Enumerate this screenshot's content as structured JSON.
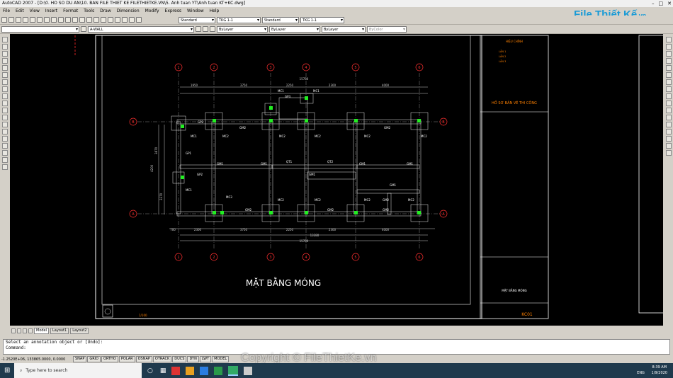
{
  "window": {
    "title": "AutoCAD 2007 - [D:\\0. HO SO DU AN\\10. BAN FILE THIET KE FILETHIETKE.VN\\5. Anh tuan YT\\Anh tuan KT+KC.dwg]"
  },
  "menu": [
    "File",
    "Edit",
    "View",
    "Insert",
    "Format",
    "Tools",
    "Draw",
    "Dimension",
    "Modify",
    "Express",
    "Window",
    "Help"
  ],
  "toolbar": {
    "text_style": "Standard",
    "dim_style": "TKG 1-1",
    "table_style": "Standard",
    "mleader_style": "TKG 1-1",
    "layer": "A-WALL",
    "color": "ByLayer",
    "linetype": "ByLayer",
    "lineweight": "ByLayer",
    "plotstyle": "ByColor"
  },
  "logo": {
    "main": "File Thiết Kế",
    "suffix": ".vn"
  },
  "drawing": {
    "title": "MẶT BẰNG MÓNG",
    "axes_x": [
      "1",
      "2",
      "3",
      "4",
      "5",
      "6"
    ],
    "axes_y": [
      "A",
      "B"
    ],
    "overall_dim": "15780",
    "top_dims": [
      "1950",
      "3750",
      "2250",
      "2300",
      "4000"
    ],
    "bottom_dims": [
      "700",
      "2300",
      "3750",
      "2250",
      "2300",
      "4000"
    ],
    "bottom_dim2": "13380",
    "left_dims": [
      "3870",
      "4200",
      "3370"
    ],
    "labels": {
      "mc1": "MC1",
      "mc2": "MC2",
      "mc3": "MC3",
      "gm1": "GM1",
      "gm2": "GM2",
      "gp1": "GP1",
      "gp2": "GP2",
      "gp3": "GP3",
      "qt1": "QT1",
      "qt2": "QT2"
    },
    "stamp": "HỒ SƠ BẢN VẼ THI CÔNG",
    "sheet_code": "KC01",
    "sheet_name": "MẶT BẰNG MÓNG",
    "revision_header": "HIỆU CHỈNH",
    "revisions": [
      "LẦN 1",
      "LẦN 2",
      "LẦN 3"
    ],
    "scale": "1/100"
  },
  "tabs": [
    "Model",
    "Layout1",
    "Layout2"
  ],
  "command": {
    "line1": "Select an annotation object or [Undo]:",
    "line2": "Command:"
  },
  "status": {
    "coords": "-1.2520E+06, 133865.0000, 0.0000",
    "buttons": [
      "SNAP",
      "GRID",
      "ORTHO",
      "POLAR",
      "OSNAP",
      "OTRACK",
      "DUCS",
      "DYN",
      "LWT",
      "MODEL"
    ]
  },
  "taskbar": {
    "search": "Type here to search",
    "time": "8:39 AM",
    "date": "1/9/2020",
    "lang": "ENG"
  },
  "watermark": "Copyright © FileThietKe.vn",
  "colors": {
    "canvas": "#000000",
    "column": "#22ee22",
    "axis_circle": "#ff3030",
    "dim": "#cccccc",
    "frame": "#ffffff",
    "title_text": "#ffffff",
    "block_text": "#ff8000"
  }
}
